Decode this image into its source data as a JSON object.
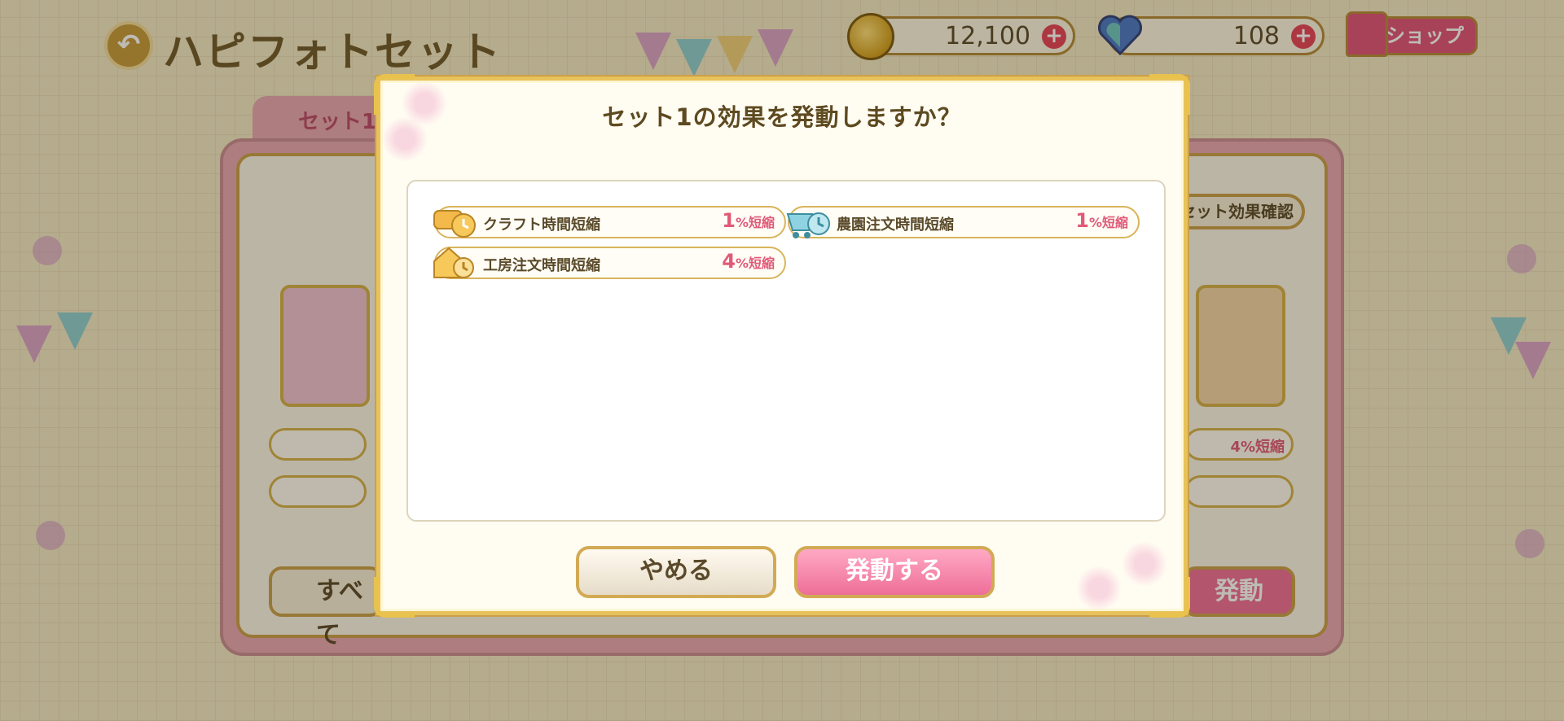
{
  "header": {
    "title": "ハピフォトセット",
    "back_icon": "back-arrow-icon"
  },
  "currencies": {
    "coins": "12,100",
    "gems": "108"
  },
  "shop": {
    "label": "ショップ"
  },
  "background_panel": {
    "tab_label": "セット1",
    "effect_confirm_label": "セット効果確認",
    "row_pct": "4%短縮",
    "all_button": "すべて",
    "activate_button": "発動"
  },
  "dialog": {
    "title": "セット1の効果を発動しますか？",
    "effects": [
      {
        "name": "クラフト時間短縮",
        "value": "1",
        "unit": "%短縮",
        "icon": "craft-clock-icon"
      },
      {
        "name": "農園注文時間短縮",
        "value": "1",
        "unit": "%短縮",
        "icon": "farm-cart-clock-icon"
      },
      {
        "name": "工房注文時間短縮",
        "value": "4",
        "unit": "%短縮",
        "icon": "workshop-clock-icon"
      }
    ],
    "cancel_label": "やめる",
    "confirm_label": "発動する"
  },
  "colors": {
    "gold_border": "#d9b45c",
    "pink_accent": "#e05a78",
    "confirm_pink": "#ee6e98"
  }
}
